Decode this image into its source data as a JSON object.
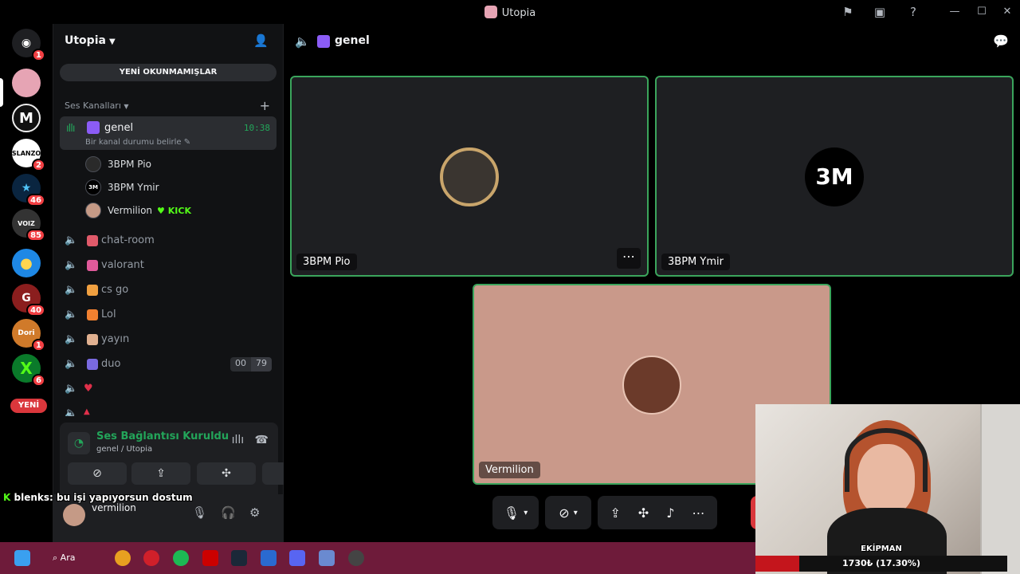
{
  "window": {
    "title": "Utopia",
    "controls": [
      "flag-icon",
      "screen-share-icon",
      "help-icon",
      "minimize",
      "maximize",
      "close"
    ]
  },
  "guilds": {
    "servers": [
      {
        "name": "discord-home",
        "badge": "1",
        "color": "#5865f2"
      },
      {
        "name": "utopia",
        "badge": "",
        "color": "#e6a4b4"
      },
      {
        "name": "m-server",
        "badge": "",
        "color": "#111111"
      },
      {
        "name": "slanzo",
        "badge": "2",
        "color": "#ffffff"
      },
      {
        "name": "star-server",
        "badge": "46",
        "color": "#0a2540"
      },
      {
        "name": "voice-server",
        "badge": "85",
        "color": "#333333"
      },
      {
        "name": "yellow-server",
        "badge": "",
        "color": "#1e88e5"
      },
      {
        "name": "g-server",
        "badge": "40",
        "color": "#8b1e1e"
      },
      {
        "name": "dori-server",
        "badge": "1",
        "color": "#d07a2a"
      },
      {
        "name": "x-server",
        "badge": "6",
        "color": "#0a7a2a"
      }
    ],
    "new_label": "YENİ"
  },
  "sidebar": {
    "server_name": "Utopia",
    "unread_label": "YENİ OKUNMAMIŞLAR",
    "category": "Ses Kanalları",
    "active_channel": {
      "name": "genel",
      "time": "10:38",
      "status": "Bir kanal durumu belirle"
    },
    "members": [
      {
        "name": "3BPM Pio",
        "tag": ""
      },
      {
        "name": "3BPM Ymir",
        "tag": ""
      },
      {
        "name": "Vermilion",
        "tag": "KICK"
      }
    ],
    "channels": [
      {
        "name": "chat-room",
        "emoji_color": "#e05a6a",
        "count_a": "",
        "count_b": ""
      },
      {
        "name": "valorant",
        "emoji_color": "#e05a9a",
        "count_a": "",
        "count_b": ""
      },
      {
        "name": "cs go",
        "emoji_color": "#f0a040",
        "count_a": "",
        "count_b": ""
      },
      {
        "name": "Lol",
        "emoji_color": "#f08030",
        "count_a": "",
        "count_b": ""
      },
      {
        "name": "yayın",
        "emoji_color": "#e0b090",
        "count_a": "",
        "count_b": ""
      },
      {
        "name": "duo",
        "emoji_color": "#7a6ae0",
        "count_a": "00",
        "count_b": "79"
      },
      {
        "name": "♥",
        "emoji_color": "",
        "count_a": "",
        "count_b": ""
      },
      {
        "name": "▲",
        "emoji_color": "",
        "count_a": "",
        "count_b": ""
      }
    ]
  },
  "voice_panel": {
    "title": "Ses Bağlantısı Kuruldu",
    "subtitle": "genel / Utopia"
  },
  "user": {
    "name": "vermilion"
  },
  "chat_overlay": {
    "user": "blenks",
    "message": ": bu işi yapıyorsun dostum"
  },
  "main": {
    "channel": "genel",
    "tiles": [
      {
        "name": "3BPM Pio"
      },
      {
        "name": "3BPM Ymir",
        "logo": "3M"
      },
      {
        "name": "Vermilion"
      }
    ]
  },
  "cam": {
    "label": "EKİPMAN",
    "bar_text": "1730₺ (17.30%)",
    "progress": 0.173
  },
  "taskbar": {
    "search_label": "Ara"
  }
}
